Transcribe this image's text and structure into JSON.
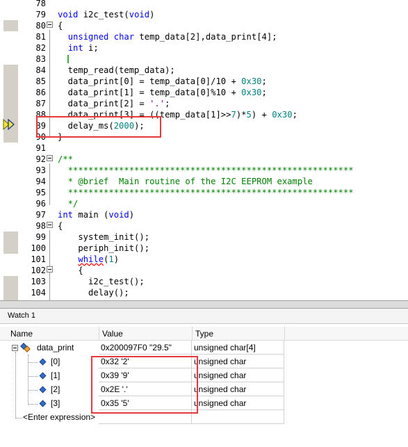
{
  "editor": {
    "lines": [
      {
        "num": "78",
        "text": ""
      },
      {
        "num": "79",
        "text": "void i2c_test(void)"
      },
      {
        "num": "80",
        "text": "{"
      },
      {
        "num": "81",
        "text": "  unsigned char temp_data[2],data_print[4];"
      },
      {
        "num": "82",
        "text": "  int i;"
      },
      {
        "num": "83",
        "text": ""
      },
      {
        "num": "84",
        "text": "  temp_read(temp_data);"
      },
      {
        "num": "85",
        "text": "  data_print[0] = temp_data[0]/10 + 0x30;"
      },
      {
        "num": "86",
        "text": "  data_print[1] = temp_data[0]%10 + 0x30;"
      },
      {
        "num": "87",
        "text": "  data_print[2] = '.';"
      },
      {
        "num": "88",
        "text": "  data_print[3] = ((temp_data[1]>>7)*5) + 0x30;"
      },
      {
        "num": "89",
        "text": "  delay_ms(2000);"
      },
      {
        "num": "90",
        "text": "}"
      },
      {
        "num": "91",
        "text": ""
      },
      {
        "num": "92",
        "text": "/**"
      },
      {
        "num": "93",
        "text": "  ********************************************************"
      },
      {
        "num": "94",
        "text": "  * @brief  Main routine of the I2C EEPROM example"
      },
      {
        "num": "95",
        "text": "  ********************************************************"
      },
      {
        "num": "96",
        "text": "  */"
      },
      {
        "num": "97",
        "text": "int main (void)"
      },
      {
        "num": "98",
        "text": "{"
      },
      {
        "num": "99",
        "text": "    system_init();"
      },
      {
        "num": "100",
        "text": "    periph_init();"
      },
      {
        "num": "101",
        "text": "    while(1)"
      },
      {
        "num": "102",
        "text": "    {"
      },
      {
        "num": "103",
        "text": "      i2c_test();"
      },
      {
        "num": "104",
        "text": "      delay();"
      }
    ]
  },
  "watch": {
    "title": "Watch 1",
    "columns": {
      "name": "Name",
      "value": "Value",
      "type": "Type"
    },
    "root": {
      "name": "data_print",
      "value": "0x200097F0 \"29.5\"",
      "type": "unsigned char[4]"
    },
    "children": [
      {
        "name": "[0]",
        "value": "0x32 '2'",
        "type": "unsigned char"
      },
      {
        "name": "[1]",
        "value": "0x39 '9'",
        "type": "unsigned char"
      },
      {
        "name": "[2]",
        "value": "0x2E '.'",
        "type": "unsigned char"
      },
      {
        "name": "[3]",
        "value": "0x35 '5'",
        "type": "unsigned char"
      }
    ],
    "enter_expression": "<Enter expression>"
  },
  "colors": {
    "highlight_box": "#e8383d",
    "keyword": "#0000ff",
    "number": "#008080",
    "comment": "#008000",
    "current_line_arrow": "#f2e33a"
  },
  "icons": {
    "current_line": "execution-arrow-icon",
    "variable": "watch-variable-icon",
    "element": "array-element-icon"
  }
}
